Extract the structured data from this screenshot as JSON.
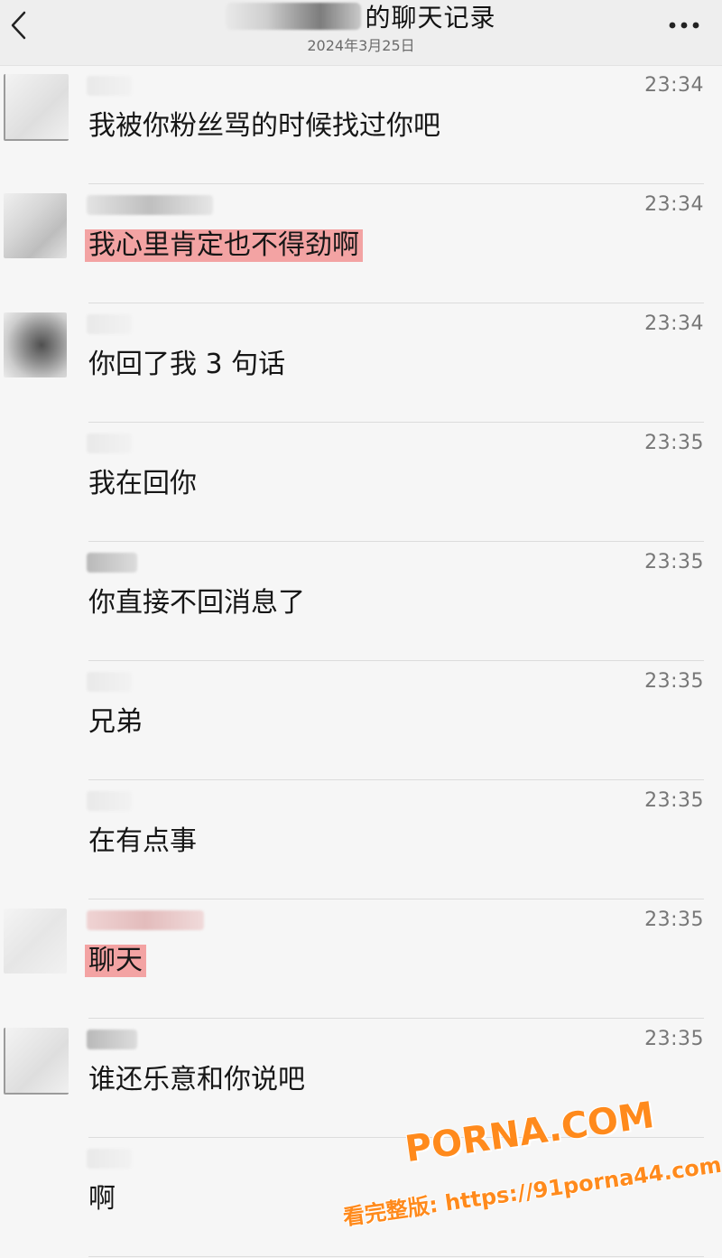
{
  "header": {
    "title": "的聊天记录",
    "date": "2024年3月25日",
    "more_label": "•••"
  },
  "messages": [
    {
      "time": "23:34",
      "text": "我被你粉丝骂的时候找过你吧",
      "highlighted": false
    },
    {
      "time": "23:34",
      "text": "我心里肯定也不得劲啊",
      "highlighted": true
    },
    {
      "time": "23:34",
      "text": "你回了我 3 句话",
      "highlighted": false
    },
    {
      "time": "23:35",
      "text": "我在回你",
      "highlighted": false
    },
    {
      "time": "23:35",
      "text": "你直接不回消息了",
      "highlighted": false
    },
    {
      "time": "23:35",
      "text": "兄弟",
      "highlighted": false
    },
    {
      "time": "23:35",
      "text": "在有点事",
      "highlighted": false
    },
    {
      "time": "23:35",
      "text": "聊天",
      "highlighted": true
    },
    {
      "time": "23:35",
      "text": "谁还乐意和你说吧",
      "highlighted": false
    },
    {
      "time": "",
      "text": "啊",
      "highlighted": false
    }
  ],
  "watermark": {
    "brand": "PORNA.COM",
    "url": "看完整版: https://91porna44.com"
  },
  "colors": {
    "highlight": "#f3a3a3",
    "watermark": "#ff8a1c",
    "background": "#f6f6f6"
  }
}
